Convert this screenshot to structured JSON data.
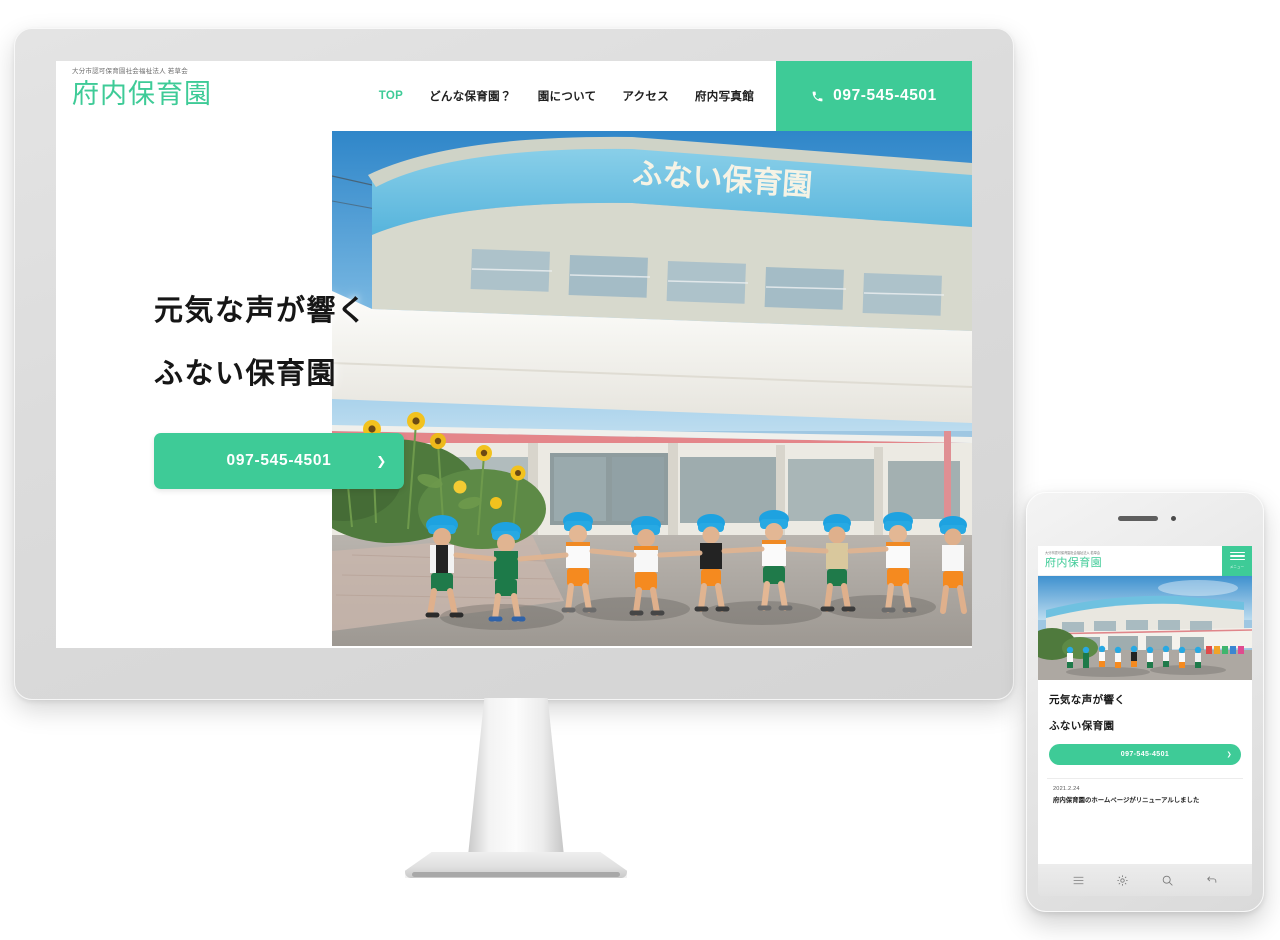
{
  "brand": {
    "kicker": "大分市認可保育園社会福祉法人 若草会",
    "name": "府内保育園"
  },
  "nav": {
    "items": [
      {
        "label": "TOP",
        "active": true
      },
      {
        "label": "どんな保育園？",
        "active": false
      },
      {
        "label": "園について",
        "active": false
      },
      {
        "label": "アクセス",
        "active": false
      },
      {
        "label": "府内写真館",
        "active": false
      }
    ]
  },
  "header_tel": {
    "icon": "phone-icon",
    "number": "097-545-4501"
  },
  "hero": {
    "line1": "元気な声が響く",
    "line2": "ふない保育園",
    "cta_label": "097-545-4501",
    "cta_chevron": "❯",
    "photo_alt": "園舎の前で手をつないで歩く園児たち",
    "signage": "ふない保育園"
  },
  "mobile": {
    "brand_kicker": "大分市認可保育園社会福祉法人 若草会",
    "brand_name": "府内保育園",
    "menu_label": "メニュー",
    "hero_line1": "元気な声が響く",
    "hero_line2": "ふない保育園",
    "cta_label": "097-545-4501",
    "cta_chevron": "❯",
    "news_date": "2021.2.24",
    "news_title": "府内保育園のホームページがリニューアルしました",
    "navbar_icons": [
      "menu-icon",
      "settings-icon",
      "search-icon",
      "back-icon"
    ]
  },
  "colors": {
    "accent_green": "#3ecb97",
    "device_gray": "#dcdcdc",
    "text_dark": "#161616"
  }
}
